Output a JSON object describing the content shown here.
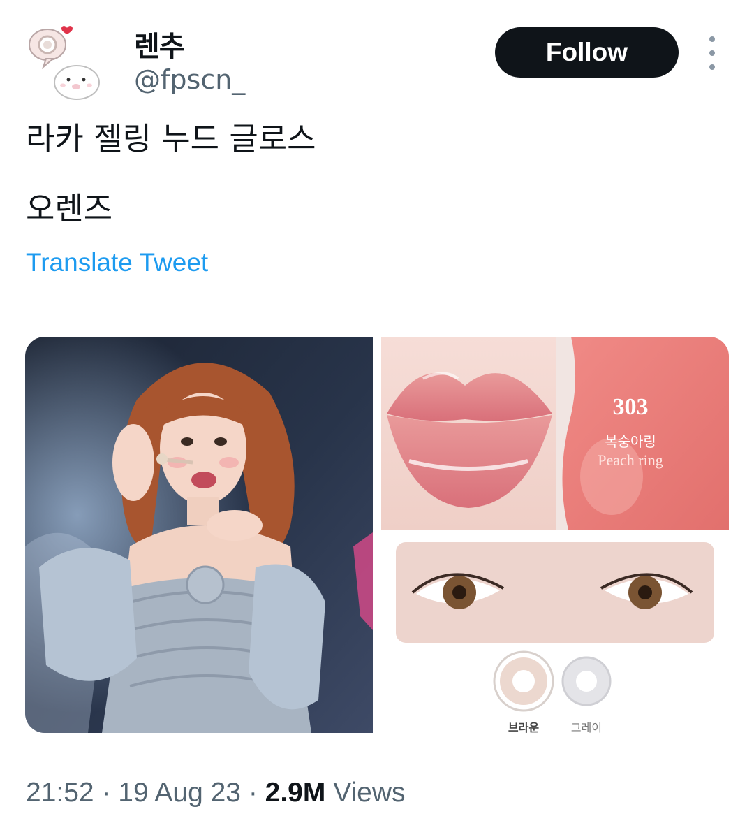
{
  "author": {
    "display_name": "렌추",
    "handle": "@fpscn_",
    "avatar_icon": "seal-avatar-icon"
  },
  "actions": {
    "follow_label": "Follow",
    "more_icon": "more-vertical-icon"
  },
  "tweet": {
    "lines": [
      "라카 젤링 누드 글로스",
      "오렌즈"
    ],
    "translate_label": "Translate Tweet"
  },
  "media": {
    "swatch_number": "303",
    "swatch_name_kr": "복숭아링",
    "swatch_name_en": "Peach ring",
    "lens_options": [
      "브라운",
      "그레이"
    ]
  },
  "meta": {
    "time": "21:52",
    "separator": "·",
    "date": "19 Aug 23",
    "views_count": "2.9M",
    "views_label": "Views"
  },
  "colors": {
    "follow_bg": "#0f1419",
    "link": "#1d9bf0",
    "secondary_text": "#536471"
  }
}
